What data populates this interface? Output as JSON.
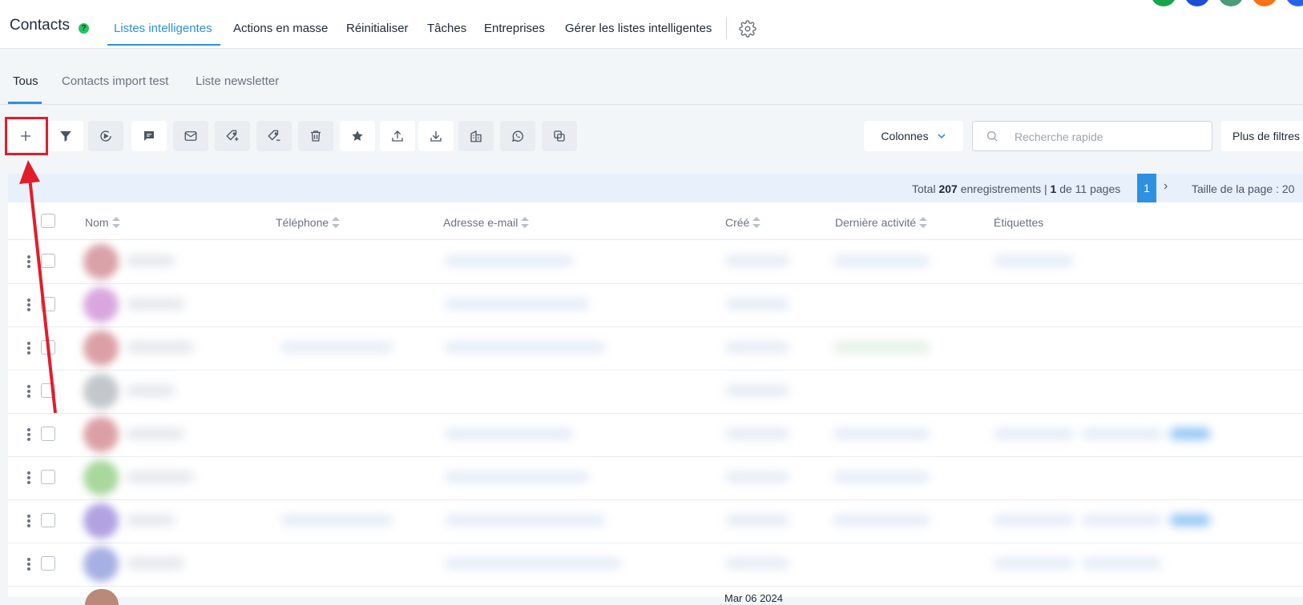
{
  "header": {
    "brand": "Contacts",
    "help_icon": "?",
    "nav": [
      {
        "label": "Listes intelligentes",
        "active": true
      },
      {
        "label": "Actions en masse"
      },
      {
        "label": "Réinitialiser"
      },
      {
        "label": "Tâches"
      },
      {
        "label": "Entreprises"
      },
      {
        "label": "Gérer les listes intelligentes"
      }
    ],
    "settings_icon": "gear-icon",
    "avatar_colors": [
      "#16a34a",
      "#1d4ed8",
      "#4c9a7a",
      "#f97316",
      "#2563eb"
    ]
  },
  "subtabs": [
    {
      "label": "Tous",
      "active": true
    },
    {
      "label": "Contacts import test"
    },
    {
      "label": "Liste newsletter"
    }
  ],
  "toolbar": {
    "buttons": [
      "plus-icon",
      "filter-icon",
      "workflow-icon",
      "sms-icon",
      "email-icon",
      "tag-add-icon",
      "tag-remove-icon",
      "trash-icon",
      "star-icon",
      "upload-icon",
      "download-icon",
      "building-icon",
      "whatsapp-icon",
      "duplicate-icon"
    ],
    "columns_label": "Colonnes",
    "search_placeholder": "Recherche rapide",
    "more_filters_label": "Plus de filtres"
  },
  "pagination": {
    "total_prefix": "Total ",
    "total_count": "207",
    "total_suffix": " enregistrements | ",
    "current_page": "1",
    "pages_suffix": " de 11 pages",
    "page_button": "1",
    "page_size": "Taille de la page : 20"
  },
  "table": {
    "columns": [
      "Nom",
      "Téléphone",
      "Adresse e-mail",
      "Créé",
      "Dernière activité",
      "Étiquettes"
    ],
    "row_count": 8,
    "partial_row_created": "Mar 06 2024"
  },
  "annotation": {
    "highlight_color": "#e11d2a"
  }
}
